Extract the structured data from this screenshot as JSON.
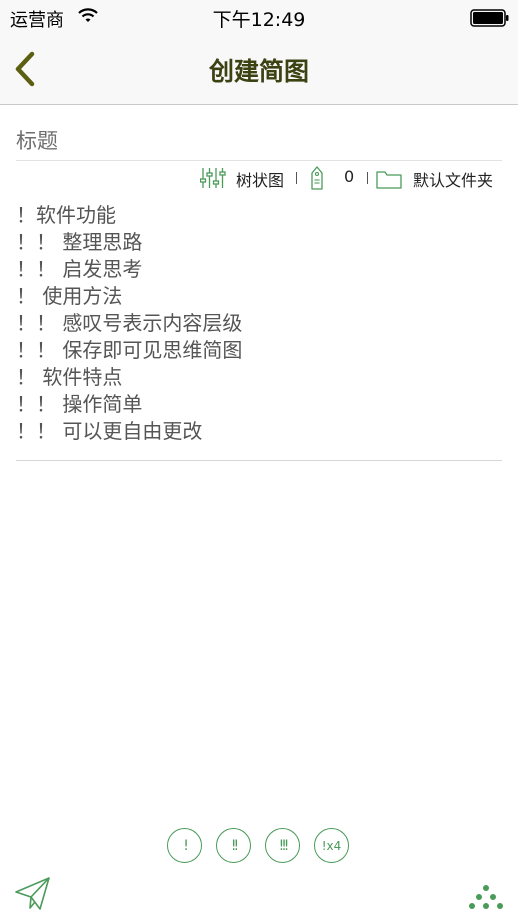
{
  "status_bar": {
    "carrier": "运营商",
    "time": "下午12:49",
    "icons": [
      "wifi-icon",
      "battery-icon"
    ]
  },
  "nav": {
    "title": "创建简图",
    "back_icon": "chevron-left-icon"
  },
  "title_field": {
    "placeholder": "标题",
    "value": ""
  },
  "toolbar": {
    "layout_label": "树状图",
    "tag_count": "0",
    "folder_label": "默认文件夹",
    "icons": [
      "sliders-icon",
      "tag-icon",
      "folder-icon"
    ]
  },
  "content": {
    "lines": [
      "！软件功能",
      "！！ 整理思路",
      "！！ 启发思考",
      "！ 使用方法",
      "！！ 感叹号表示内容层级",
      "！！ 保存即可见思维简图",
      "！ 软件特点",
      "！！ 操作简单",
      "！！ 可以更自由更改"
    ]
  },
  "level_buttons": {
    "level1": "!",
    "level2": "!!",
    "level3": "!!!",
    "level4_mark": "!",
    "level4_suffix": "x4"
  },
  "bottom": {
    "send_icon": "paper-plane-icon",
    "more_icon": "dots-triangle-icon"
  },
  "colors": {
    "accent": "#4a9a5a",
    "title": "#3d4213",
    "back": "#5c5e12"
  }
}
